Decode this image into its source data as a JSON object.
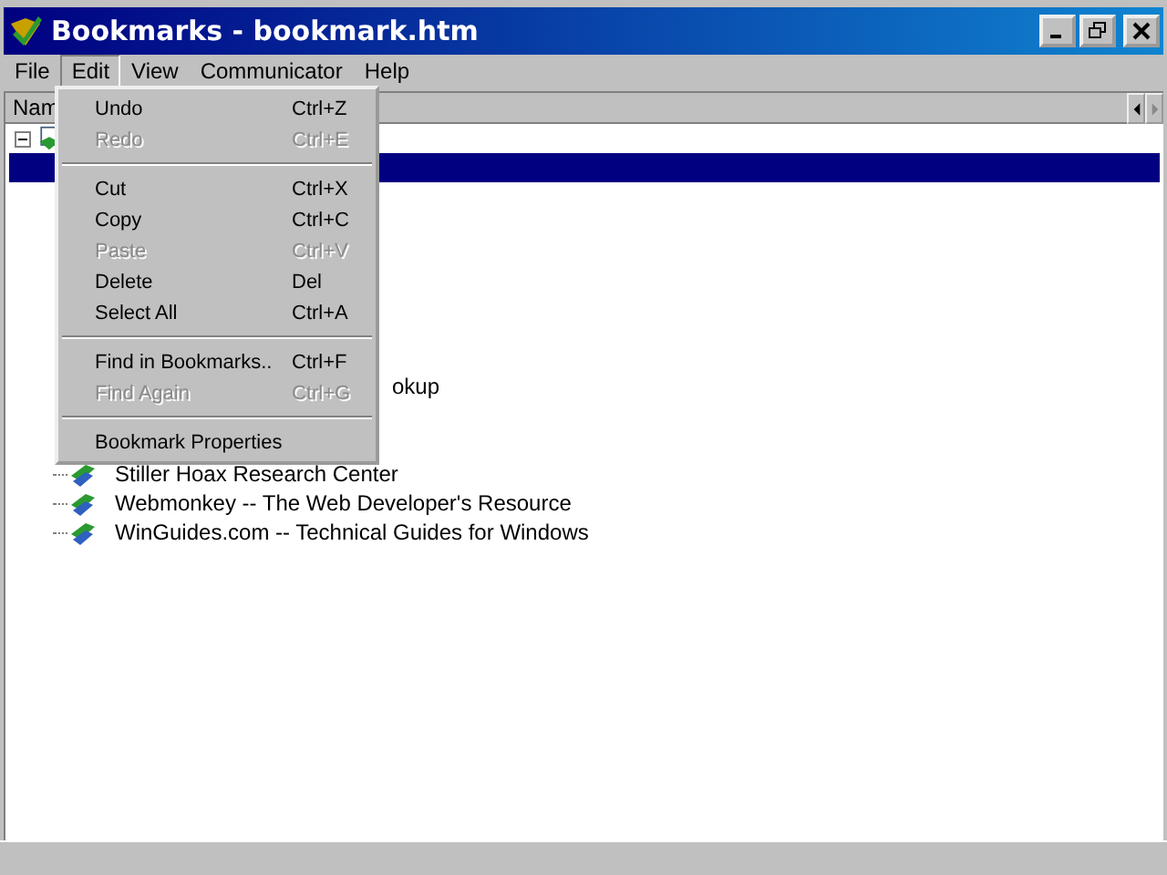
{
  "window": {
    "title": "Bookmarks - bookmark.htm"
  },
  "menu_bar": [
    {
      "label": "File",
      "selected": false
    },
    {
      "label": "Edit",
      "selected": true
    },
    {
      "label": "View",
      "selected": false
    },
    {
      "label": "Communicator",
      "selected": false
    },
    {
      "label": "Help",
      "selected": false
    }
  ],
  "edit_menu": [
    {
      "kind": "item",
      "label": "Undo",
      "shortcut": "Ctrl+Z",
      "disabled": false
    },
    {
      "kind": "item",
      "label": "Redo",
      "shortcut": "Ctrl+E",
      "disabled": true
    },
    {
      "kind": "separator"
    },
    {
      "kind": "item",
      "label": "Cut",
      "shortcut": "Ctrl+X",
      "disabled": false
    },
    {
      "kind": "item",
      "label": "Copy",
      "shortcut": "Ctrl+C",
      "disabled": false
    },
    {
      "kind": "item",
      "label": "Paste",
      "shortcut": "Ctrl+V",
      "disabled": true
    },
    {
      "kind": "item",
      "label": "Delete",
      "shortcut": "Del",
      "disabled": false
    },
    {
      "kind": "item",
      "label": "Select All",
      "shortcut": "Ctrl+A",
      "disabled": false
    },
    {
      "kind": "separator"
    },
    {
      "kind": "item",
      "label": "Find in Bookmarks..",
      "shortcut": "Ctrl+F",
      "disabled": false
    },
    {
      "kind": "item",
      "label": "Find Again",
      "shortcut": "Ctrl+G",
      "disabled": true
    },
    {
      "kind": "separator"
    },
    {
      "kind": "item",
      "label": "Bookmark Properties",
      "disabled": false
    }
  ],
  "column_header": "Nam",
  "tree": {
    "expanded": true,
    "selected": false,
    "children": [
      {
        "kind": "blank",
        "selected": true
      },
      {
        "kind": "partial",
        "label": "okup",
        "selected": false
      },
      {
        "kind": "bookmark",
        "label": "Stiller Hoax Research Center",
        "selected": false
      },
      {
        "kind": "bookmark",
        "label": "Webmonkey -- The Web Developer's Resource",
        "selected": false
      },
      {
        "kind": "bookmark",
        "label": "WinGuides.com -- Technical Guides for Windows",
        "selected": false
      }
    ]
  }
}
